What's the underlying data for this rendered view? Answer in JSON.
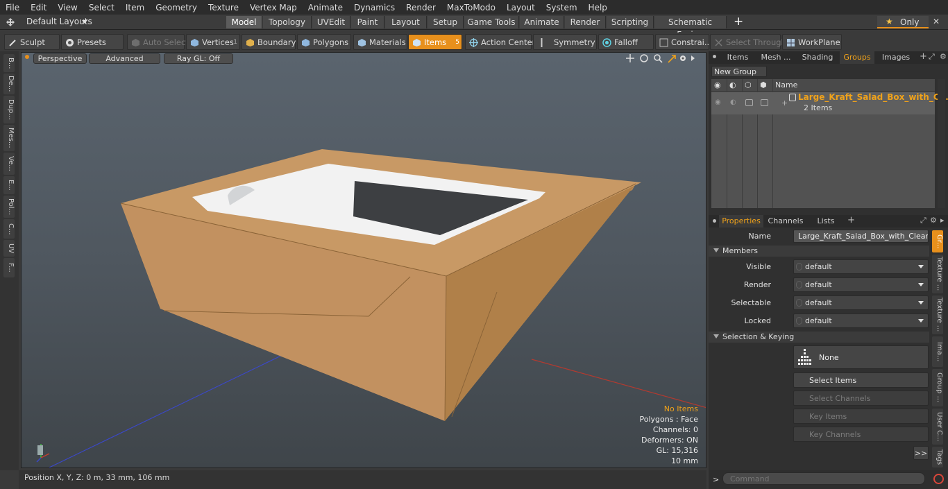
{
  "menu": [
    "File",
    "Edit",
    "View",
    "Select",
    "Item",
    "Geometry",
    "Texture",
    "Vertex Map",
    "Animate",
    "Dynamics",
    "Render",
    "MaxToModo",
    "Layout",
    "System",
    "Help"
  ],
  "layouts": {
    "dropdown": "Default Layouts",
    "tabs": [
      "Model",
      "Topology",
      "UVEdit",
      "Paint",
      "Layout",
      "Setup",
      "Game Tools",
      "Animate",
      "Render",
      "Scripting",
      "Schematic Fusion"
    ],
    "add": "+",
    "only": "Only",
    "close": "✕"
  },
  "toolbar": {
    "sculpt": "Sculpt",
    "presets": "Presets",
    "auto_select": "Auto Select",
    "vertices": "Vertices",
    "vertices_badge": "1",
    "boundary": "Boundary",
    "polygons": "Polygons",
    "materials": "Materials",
    "items": "Items",
    "items_badge": "5",
    "action_center": "Action Center",
    "symmetry": "Symmetry",
    "falloff": "Falloff",
    "constraints": "Constrai...",
    "select_through": "Select Through",
    "workplane": "WorkPlane"
  },
  "left_tabs": [
    "B...",
    "De...",
    "Dup...",
    "Mes...",
    "Ve...",
    "E...",
    "Pol...",
    "C...",
    "UV",
    "F..."
  ],
  "viewport": {
    "perspective": "Perspective",
    "advanced": "Advanced",
    "raygl": "Ray GL: Off",
    "stats": {
      "items": "No Items",
      "polygons": "Polygons : Face",
      "channels": "Channels: 0",
      "deformers": "Deformers: ON",
      "gl": "GL: 15,316",
      "scale": "10 mm"
    }
  },
  "status": {
    "position": "Position X, Y, Z:  0 m, 33 mm, 106 mm"
  },
  "groups_panel": {
    "tabs": [
      "Items",
      "Mesh ...",
      "Shading",
      "Groups",
      "Images"
    ],
    "new_group": "New Group",
    "col_name": "Name",
    "group_name": "Large_Kraft_Salad_Box_with_Cl...",
    "group_count": "2 Items"
  },
  "properties_panel": {
    "tabs": [
      "Properties",
      "Channels",
      "Lists"
    ],
    "name_label": "Name",
    "name_value": "Large_Kraft_Salad_Box_with_Clear_W",
    "members_header": "Members",
    "visible_label": "Visible",
    "visible_value": "default",
    "render_label": "Render",
    "render_value": "default",
    "selectable_label": "Selectable",
    "selectable_value": "default",
    "locked_label": "Locked",
    "locked_value": "default",
    "sel_keying_header": "Selection & Keying",
    "none_label": "None",
    "select_items": "Select Items",
    "select_channels": "Select Channels",
    "key_items": "Key Items",
    "key_channels": "Key Channels",
    "more": ">>",
    "side_tabs": [
      "Gr...",
      "Texture ...",
      "Texture ...",
      "Ima...",
      "Group ...",
      "User C...",
      "Tags"
    ]
  },
  "command": {
    "prompt": ">",
    "placeholder": "Command"
  },
  "colors": {
    "accent": "#e8901c",
    "group_text": "#f0a21a"
  }
}
